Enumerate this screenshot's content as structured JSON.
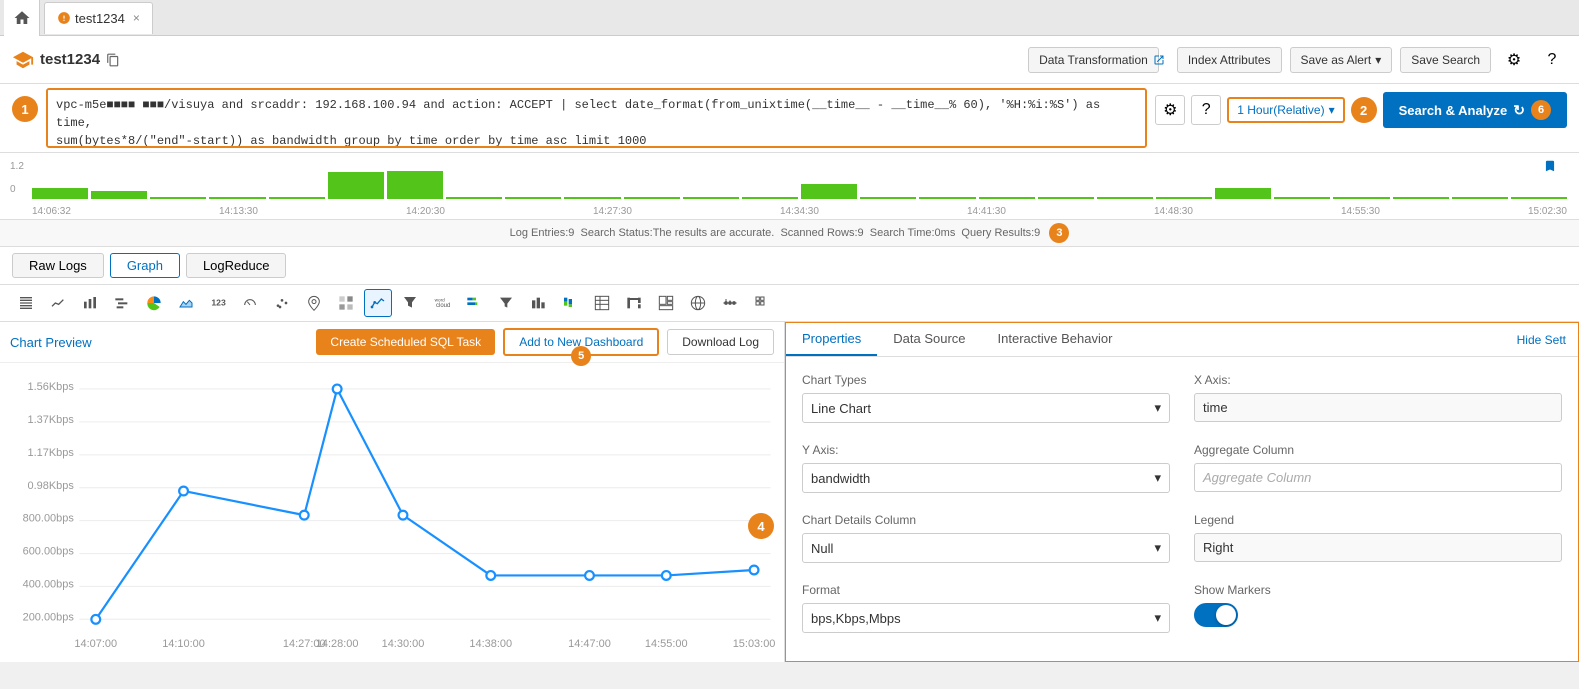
{
  "tab": {
    "title": "test1234",
    "close": "×"
  },
  "toolbar": {
    "app_title": "test1234",
    "data_transformation": "Data Transformation",
    "index_attributes": "Index Attributes",
    "save_as_alert": "Save as Alert",
    "save_search": "Save Search",
    "search_analyze": "Search & Analyze"
  },
  "query": {
    "text": "vpc-m5e■■■■ ■■■/visuya and srcaddr: 192.168.100.94 and action: ACCEPT | select date_format(from_unixtime(__time__ - __time__% 60), '%H:%i:%S') as time,\nsum(bytes*8/(\"end\"-start)) as bandwidth group by time order by time asc limit 1000",
    "time_range": "1 Hour(Relative)",
    "search_analyze": "Search & Analyze"
  },
  "status": {
    "text": "Log Entries:9  Search Status:The results are accurate.  Scanned Rows:9  Search Time:0ms  Query Results:9"
  },
  "histogram": {
    "y_top": "1.2",
    "y_bottom": "0",
    "times": [
      "14:06:32",
      "14:13:30",
      "14:20:30",
      "14:27:30",
      "14:34:30",
      "14:41:30",
      "14:48:30",
      "14:55:30",
      "15:02:30"
    ]
  },
  "tabs": {
    "raw_logs": "Raw Logs",
    "graph": "Graph",
    "log_reduce": "LogReduce"
  },
  "chart_actions": {
    "preview_label": "Chart Preview",
    "create_scheduled": "Create Scheduled SQL Task",
    "add_dashboard": "Add to New Dashboard",
    "download_log": "Download Log"
  },
  "chart": {
    "y_labels": [
      "1.56Kbps",
      "1.37Kbps",
      "1.17Kbps",
      "0.98Kbps",
      "800.00bps",
      "600.00bps",
      "400.00bps",
      "200.00bps"
    ],
    "x_labels": [
      "14:07:00",
      "14:10:00",
      "14:27:00",
      "14:28:00",
      "14:30:00",
      "14:38:00",
      "14:47:00",
      "14:55:00",
      "15:03:00"
    ]
  },
  "properties": {
    "tab_properties": "Properties",
    "tab_data_source": "Data Source",
    "tab_interactive": "Interactive Behavior",
    "hide_settings": "Hide Sett",
    "chart_types_label": "Chart Types",
    "chart_type_value": "Line Chart",
    "x_axis_label": "X Axis:",
    "x_axis_value": "time",
    "y_axis_label": "Y Axis:",
    "y_axis_value": "bandwidth",
    "agg_col_label": "Aggregate Column",
    "agg_col_placeholder": "Aggregate Column",
    "chart_details_label": "Chart Details Column",
    "chart_details_value": "Null",
    "legend_label": "Legend",
    "legend_value": "Right",
    "format_label": "Format",
    "format_value": "bps,Kbps,Mbps",
    "show_markers_label": "Show Markers"
  },
  "badges": {
    "b1": "1",
    "b2": "2",
    "b3": "3",
    "b4": "4",
    "b5": "5",
    "b6": "6"
  }
}
